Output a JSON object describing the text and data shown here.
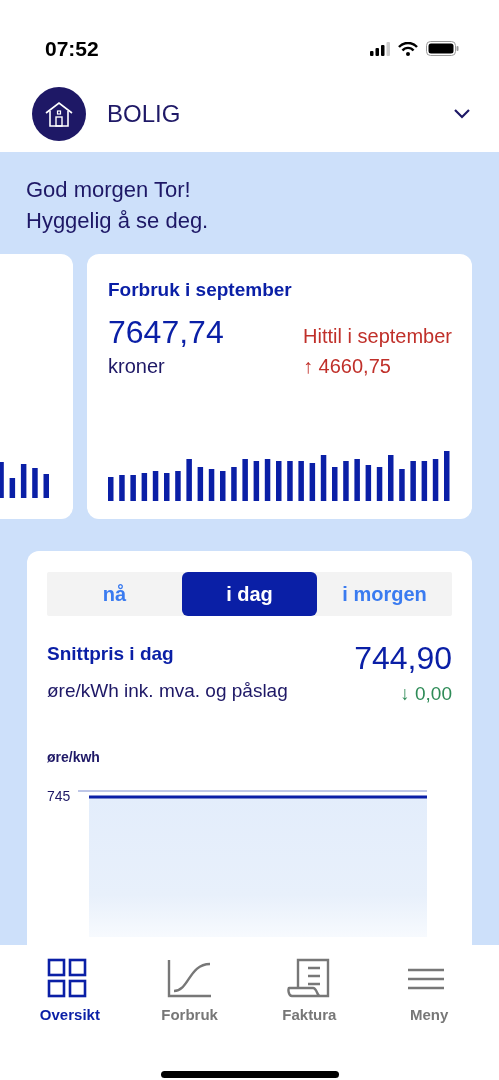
{
  "status_bar": {
    "time": "07:52"
  },
  "header": {
    "title": "BOLIG"
  },
  "greeting": [
    "God morgen Tor!",
    "Hyggelig å se deg."
  ],
  "usage_card": {
    "title": "Forbruk i september",
    "amount": "7647,74",
    "unit": "kroner",
    "comparison_label": "Hittil i september",
    "comparison_value": "↑ 4660,75"
  },
  "price_card": {
    "tabs": [
      {
        "label": "nå",
        "selected": false
      },
      {
        "label": "i dag",
        "selected": true
      },
      {
        "label": "i morgen",
        "selected": false
      }
    ],
    "title": "Snittpris i dag",
    "price": "744,90",
    "unit": "øre/kWh ink. mva. og påslag",
    "change": "↓ 0,00",
    "chart": {
      "ylabel": "øre/kwh",
      "y_tick_label": "745"
    }
  },
  "bottom_nav": [
    {
      "label": "Oversikt",
      "kind": "overview",
      "selected": true
    },
    {
      "label": "Forbruk",
      "kind": "usage",
      "selected": false
    },
    {
      "label": "Faktura",
      "kind": "invoice",
      "selected": false
    },
    {
      "label": "Meny",
      "kind": "menu",
      "selected": false
    }
  ]
}
